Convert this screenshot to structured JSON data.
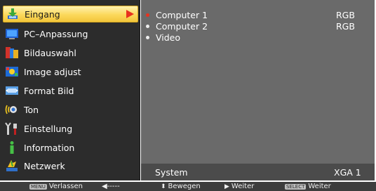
{
  "menu": {
    "items": [
      {
        "label": "Eingang",
        "icon": "input-icon",
        "selected": true
      },
      {
        "label": "PC–Anpassung",
        "icon": "pc-adjust-icon"
      },
      {
        "label": "Bildauswahl",
        "icon": "image-select-icon"
      },
      {
        "label": "Image adjust",
        "icon": "image-adjust-icon"
      },
      {
        "label": "Format Bild",
        "icon": "screen-format-icon"
      },
      {
        "label": "Ton",
        "icon": "sound-icon"
      },
      {
        "label": "Einstellung",
        "icon": "setting-icon"
      },
      {
        "label": "Information",
        "icon": "information-icon"
      },
      {
        "label": "Netzwerk",
        "icon": "network-icon"
      }
    ]
  },
  "sources": [
    {
      "label": "Computer 1",
      "value": "RGB",
      "active": true
    },
    {
      "label": "Computer 2",
      "value": "RGB"
    },
    {
      "label": "Video",
      "value": ""
    }
  ],
  "system": {
    "label": "System",
    "value": "XGA 1"
  },
  "footer": {
    "exit_key": "MENU",
    "exit_label": "Verlassen",
    "back_label": "◀-----",
    "move_label": "Bewegen",
    "next_label": "Weiter",
    "select_key": "SELECT",
    "select_label": "Weiter"
  },
  "colors": {
    "accent": "#e8321e",
    "highlight": "#fbd85b",
    "panel": "#2c2c2c",
    "content": "#6a6a6a"
  }
}
